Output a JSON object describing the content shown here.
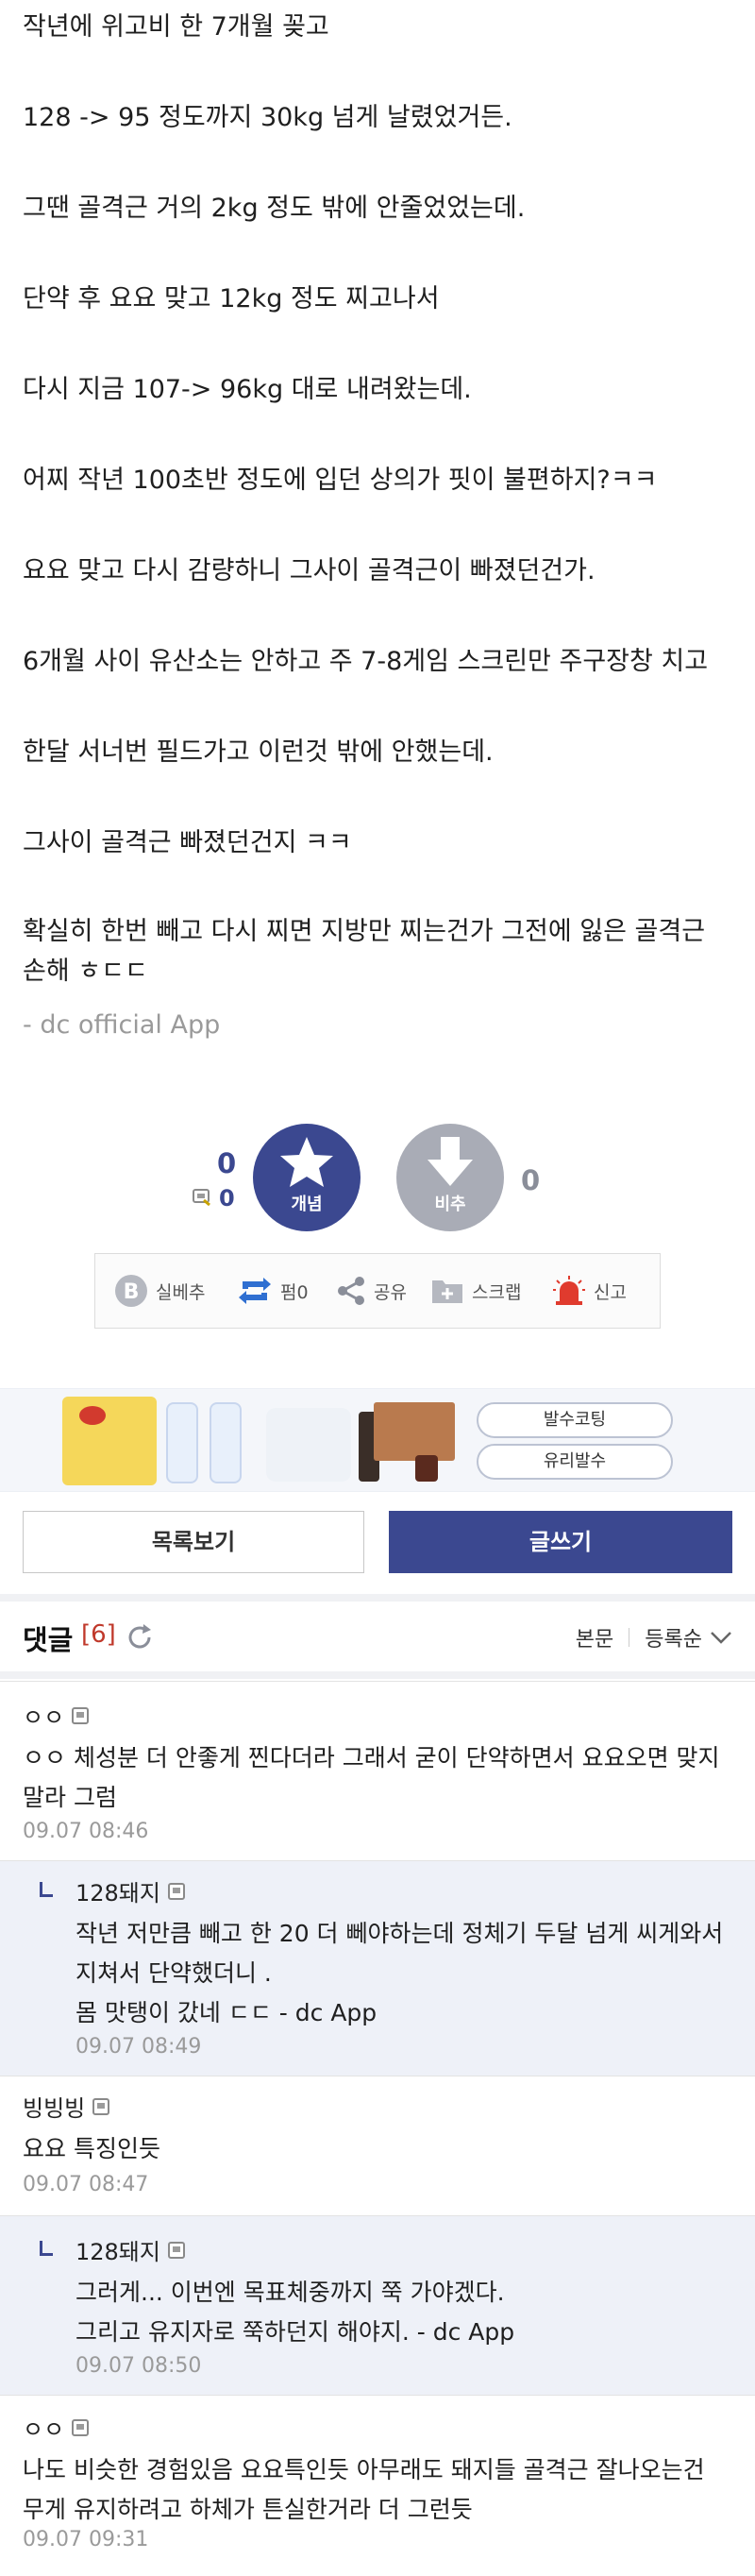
{
  "post": {
    "paragraphs": [
      "작년에 위고비 한 7개월 꽂고",
      "128 -> 95  정도까지 30kg 넘게 날렸었거든.",
      "그땐 골격근 거의 2kg 정도 밖에 안줄었었는데.",
      "단약 후 요요 맞고 12kg 정도 찌고나서",
      "다시 지금 107-> 96kg 대로 내려왔는데.",
      "어찌 작년 100초반 정도에 입던 상의가 핏이 불편하지?ㅋㅋ",
      "요요 맞고 다시 감량하니 그사이 골격근이 빠졌던건가.",
      "6개월 사이 유산소는 안하고 주 7-8게임 스크린만 주구장창 치고",
      "한달 서너번 필드가고 이런것 밖에 안했는데.",
      "그사이 골격근 빠졌던건지 ㅋㅋ",
      "확실히 한번 빼고 다시 찌면 지방만 찌는건가 그전에 잃은 골격근 손해 ㅎㄷㄷ"
    ],
    "signature": "- dc official App"
  },
  "vote": {
    "up_count": "0",
    "fixed_count": "0",
    "down_count": "0",
    "up_label": "개념",
    "down_label": "비추",
    "up_color": "#3b4890",
    "down_color": "#a9acb6"
  },
  "actions": {
    "best": "실베추",
    "share_count": "펌0",
    "share": "공유",
    "scrap": "스크랩",
    "report": "신고"
  },
  "ad": {
    "pill1": "발수코팅",
    "pill2": "유리발수"
  },
  "buttons": {
    "list": "목록보기",
    "write": "글쓰기"
  },
  "comments_header": {
    "title": "댓글",
    "count": "[6]",
    "sort_body": "본문",
    "sort_order": "등록순"
  },
  "comments": [
    {
      "nick": "ㅇㅇ",
      "body": "ㅇㅇ 체성분 더 안좋게 찐다더라 그래서 굳이 단약하면서 요요오면 맞지 말라 그럼",
      "date": "09.07 08:46",
      "reply": false
    },
    {
      "nick": "128돼지",
      "body": "작년 저만큼 빼고 한 20 더 뻬야하는데 정체기 두달 넘게 씨게와서 지쳐서 단약했더니 .\n몸 맛탱이 갔네 ㄷㄷ - dc App",
      "date": "09.07 08:49",
      "reply": true
    },
    {
      "nick": "빙빙빙",
      "body": "요요 특징인듯",
      "date": "09.07 08:47",
      "reply": false
    },
    {
      "nick": "128돼지",
      "body": "그러게... 이번엔 목표체중까지 쭉 가야겠다.\n그리고 유지자로 쭉하던지 해야지. - dc App",
      "date": "09.07 08:50",
      "reply": true
    },
    {
      "nick": "ㅇㅇ",
      "body": "나도 비슷한 경험있음 요요특인듯 아무래도 돼지들 골격근 잘나오는건 무게 유지하려고 하체가 튼실한거라 더 그런듯",
      "date": "09.07 09:31",
      "reply": false
    }
  ]
}
